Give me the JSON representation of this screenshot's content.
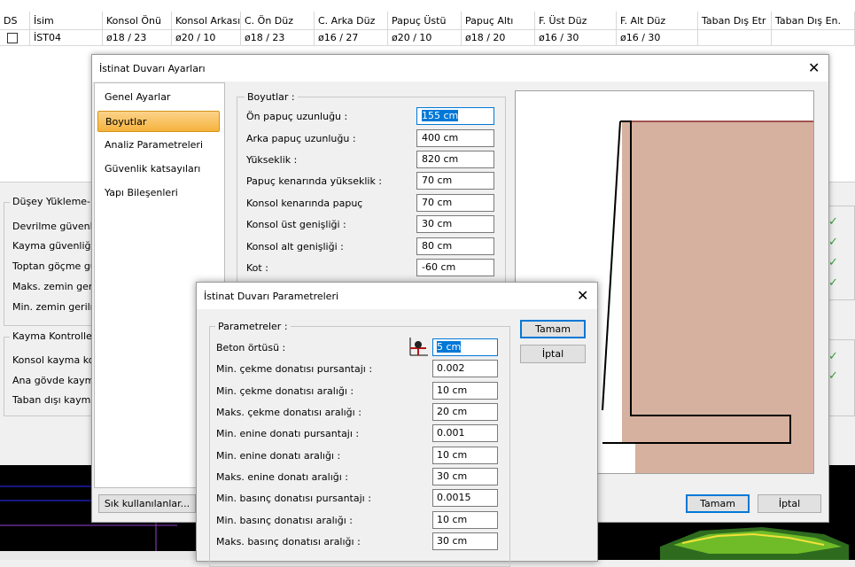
{
  "table": {
    "headers": [
      "DS",
      "İsim",
      "Konsol Önü",
      "Konsol Arkası",
      "C. Ön Düz",
      "C. Arka Düz",
      "Papuç Üstü",
      "Papuç Altı",
      "F. Üst Düz",
      "F. Alt Düz",
      "Taban Dış Etr",
      "Taban Dış En."
    ],
    "row": [
      "",
      "İST04",
      "ø18 / 23",
      "ø20 / 10",
      "ø18 / 23",
      "ø16 / 27",
      "ø20 / 10",
      "ø18 / 20",
      "ø16 / 30",
      "ø16 / 30",
      "",
      ""
    ]
  },
  "results": {
    "group1_title": "Düşey Yükleme- De",
    "group1_items": [
      "Devrilme güvenliği",
      "Kayma güvenliği :",
      "Toptan göçme güv",
      "Maks. zemin gerilm",
      "Min. zemin gerilme"
    ],
    "group2_title": "Kayma Kontrolleri -",
    "group2_items": [
      "Konsol kayma kont",
      "Ana gövde kayma",
      "Taban dışı kayma k"
    ],
    "check_glyph": "✓"
  },
  "dialog1": {
    "title": "İstinat Duvarı Ayarları",
    "close": "✕",
    "nav": [
      "Genel Ayarlar",
      "Boyutlar",
      "Analiz Parametreleri",
      "Güvenlik katsayıları",
      "Yapı Bileşenleri"
    ],
    "group_title": "Boyutlar :",
    "fields": [
      {
        "label": "Ön papuç uzunluğu :",
        "value": "155 cm"
      },
      {
        "label": "Arka papuç uzunluğu :",
        "value": "400 cm"
      },
      {
        "label": "Yükseklik :",
        "value": "820 cm"
      },
      {
        "label": "Papuç kenarında yükseklik :",
        "value": "70 cm"
      },
      {
        "label": "Konsol kenarında papuç",
        "value": "70 cm"
      },
      {
        "label": "Konsol üst genişliği :",
        "value": "30 cm"
      },
      {
        "label": "Konsol alt genişliği :",
        "value": "80 cm"
      },
      {
        "label": "Kot :",
        "value": "-60 cm"
      }
    ],
    "favorites_button": "Sık kullanılanlar...",
    "ok": "Tamam",
    "cancel": "İptal",
    "soil_color": "#d7b19f"
  },
  "dialog2": {
    "title": "İstinat Duvarı Parametreleri",
    "close": "✕",
    "group_title": "Parametreler :",
    "fields": [
      {
        "label": "Beton örtüsü :",
        "value": "5 cm"
      },
      {
        "label": "Min. çekme donatısı pursantajı :",
        "value": "0.002"
      },
      {
        "label": "Min. çekme donatısı aralığı :",
        "value": "10 cm"
      },
      {
        "label": "Maks. çekme donatısı aralığı :",
        "value": "20 cm"
      },
      {
        "label": "Min. enine donatı pursantajı :",
        "value": "0.001"
      },
      {
        "label": "Min. enine donatı aralığı :",
        "value": "10 cm"
      },
      {
        "label": "Maks. enine donatı aralığı :",
        "value": "30 cm"
      },
      {
        "label": "Min. basınç donatısı pursantajı :",
        "value": "0.0015"
      },
      {
        "label": "Min. basınç donatısı aralığı :",
        "value": "10 cm"
      },
      {
        "label": "Maks. basınç donatısı aralığı :",
        "value": "30 cm"
      }
    ],
    "ok": "Tamam",
    "cancel": "İptal",
    "cover_icon": "cover-diagram-icon"
  }
}
